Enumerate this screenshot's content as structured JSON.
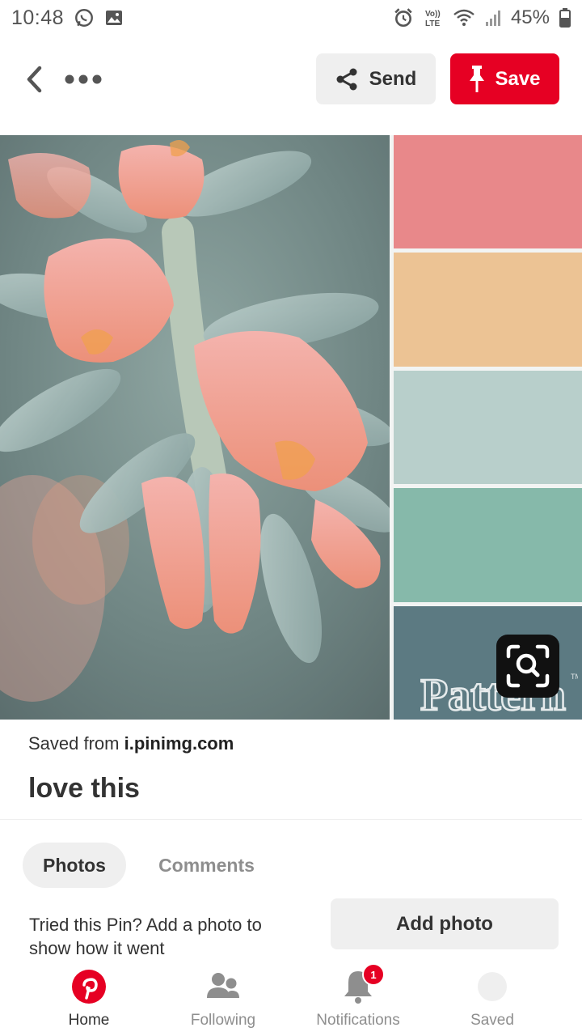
{
  "status_bar": {
    "time": "10:48",
    "network": "Vo)) LTE",
    "battery_percent": "45%"
  },
  "top_bar": {
    "send_label": "Send",
    "save_label": "Save"
  },
  "pin": {
    "palette": [
      "#e8888a",
      "#ecc394",
      "#b8cfcb",
      "#86b9aa",
      "#5c7a82"
    ],
    "watermark": "Pattern"
  },
  "details": {
    "saved_from_prefix": "Saved from",
    "saved_from_domain": "i.pinimg.com",
    "title": "love this"
  },
  "tabs": {
    "photos": "Photos",
    "comments": "Comments"
  },
  "tried": {
    "text": "Tried this Pin? Add a photo to show how it went",
    "button": "Add photo"
  },
  "nav": {
    "home": "Home",
    "following": "Following",
    "notifications": "Notifications",
    "notifications_badge": "1",
    "saved": "Saved"
  },
  "colors": {
    "brand_red": "#e60023",
    "button_gray": "#efefef"
  }
}
